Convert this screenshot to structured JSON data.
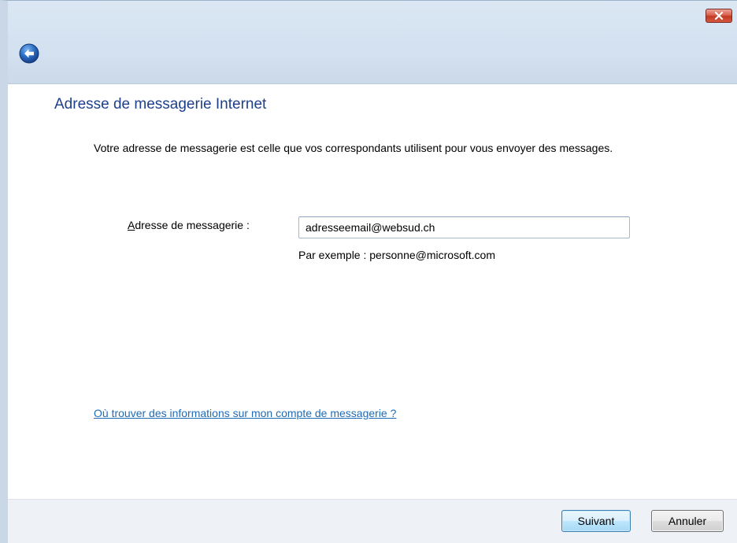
{
  "window": {
    "close_icon": "close-x-icon",
    "back_icon": "back-arrow-icon"
  },
  "page": {
    "heading": "Adresse de messagerie Internet",
    "description": "Votre adresse de messagerie est celle que vos correspondants utilisent pour vous envoyer des messages."
  },
  "form": {
    "email_label_accel": "A",
    "email_label_rest": "dresse de messagerie :",
    "email_value": "adresseemail@websud.ch",
    "example_text": "Par exemple : personne@microsoft.com"
  },
  "help": {
    "link_text": "Où trouver des informations sur mon compte de messagerie ?"
  },
  "buttons": {
    "next_label": "Suivant",
    "cancel_label": "Annuler"
  },
  "colors": {
    "heading": "#1e3f8a",
    "link": "#1f6bb5",
    "close_button": "#c23a24",
    "back_button": "#2a6cc4"
  }
}
